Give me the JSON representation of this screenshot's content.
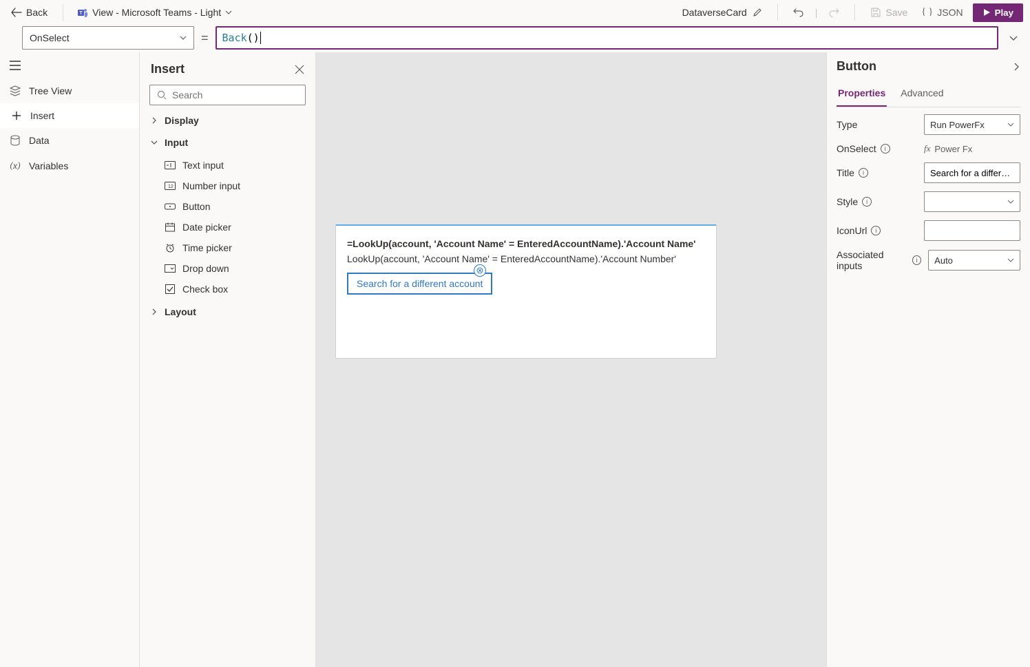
{
  "topbar": {
    "back_label": "Back",
    "theme_label": "View - Microsoft Teams - Light",
    "doc_name": "DataverseCard",
    "save_label": "Save",
    "json_label": "JSON",
    "play_label": "Play"
  },
  "formula": {
    "selected_property": "OnSelect",
    "fn": "Back",
    "args": "()"
  },
  "leftrail": {
    "items": [
      {
        "label": "Tree View"
      },
      {
        "label": "Insert"
      },
      {
        "label": "Data"
      },
      {
        "label": "Variables"
      }
    ]
  },
  "insert": {
    "title": "Insert",
    "search_placeholder": "Search",
    "groups": [
      {
        "label": "Display",
        "expanded": false,
        "items": []
      },
      {
        "label": "Input",
        "expanded": true,
        "items": [
          "Text input",
          "Number input",
          "Button",
          "Date picker",
          "Time picker",
          "Drop down",
          "Check box"
        ]
      },
      {
        "label": "Layout",
        "expanded": false,
        "items": []
      }
    ]
  },
  "canvas": {
    "line1": "=LookUp(account, 'Account Name' = EnteredAccountName).'Account Name'",
    "line2": "LookUp(account, 'Account Name' = EnteredAccountName).'Account Number'",
    "button_label": "Search for a different account"
  },
  "props": {
    "title": "Button",
    "tabs": {
      "properties": "Properties",
      "advanced": "Advanced"
    },
    "rows": {
      "type": {
        "label": "Type",
        "value": "Run PowerFx"
      },
      "onselect": {
        "label": "OnSelect",
        "value": "Power Fx"
      },
      "title_prop": {
        "label": "Title",
        "value": "Search for a different account"
      },
      "style": {
        "label": "Style",
        "value": ""
      },
      "iconurl": {
        "label": "IconUrl",
        "value": ""
      },
      "associated": {
        "label": "Associated inputs",
        "value": "Auto"
      }
    }
  }
}
